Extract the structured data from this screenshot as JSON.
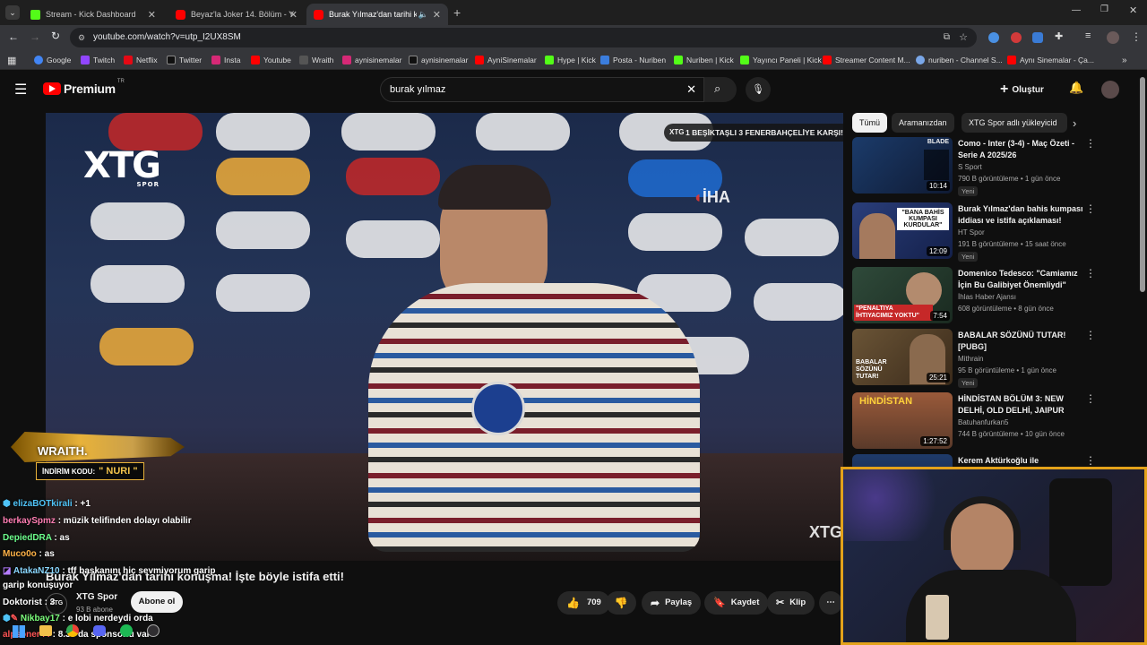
{
  "browser": {
    "tabs": [
      {
        "title": "Stream - Kick Dashboard",
        "active": false,
        "color": "#53fc18"
      },
      {
        "title": "Beyaz'la Joker 14. Bölüm - YouT",
        "active": false,
        "color": "#ff0000"
      },
      {
        "title": "Burak Yılmaz'dan tarihi konu",
        "active": true,
        "color": "#ff0000"
      }
    ],
    "url": "youtube.com/watch?v=utp_I2UX8SM",
    "bookmarks": [
      "Google",
      "Twitch",
      "Netflix",
      "Twitter",
      "Insta",
      "Youtube",
      "Wraith",
      "aynisinemalar",
      "aynisinemalar",
      "AyniSinemalar",
      "Hype | Kick",
      "Posta - Nuriben",
      "Nuriben | Kick",
      "Yayıncı Paneli | Kick",
      "Streamer Content M...",
      "nuriben - Channel S...",
      "Aynı Sinemalar - Ça..."
    ]
  },
  "youtube": {
    "logo": "Premium",
    "logo_sup": "TR",
    "search_value": "burak yılmaz",
    "create_label": "Oluştur"
  },
  "video": {
    "overlay_banner": "1 BEŞİKTAŞLI 3 FENERBAHÇELİYE KARŞI!",
    "channel_logo": "XTG",
    "channel_logo_sub": "SPOR",
    "watermark": "İHA",
    "corner_logo": "XTG",
    "title": "Burak Yılmaz'dan tarihi konuşma! İşte böyle istifa etti!",
    "channel_name": "XTG Spor",
    "subs": "93 B abone",
    "subscribe_label": "Abone ol",
    "likes": "709",
    "share_label": "Paylaş",
    "save_label": "Kaydet",
    "clip_label": "Klip"
  },
  "sponsor": {
    "brand": "WRAITH.",
    "code_label": "İNDİRİM KODU:",
    "code": "\" NURI \""
  },
  "chips": [
    "Tümü",
    "Aramanızdan",
    "XTG Spor adlı yükleyicid"
  ],
  "recommendations": [
    {
      "title": "Como - Inter (3-4) - Maç Özeti - Serie A 2025/26",
      "channel": "S Sport",
      "meta": "790 B görüntüleme • 1 gün önce",
      "badge": "Yeni",
      "duration": "10:14",
      "thumb_text": "BLADE"
    },
    {
      "title": "Burak Yılmaz'dan bahis kumpası iddiası ve istifa açıklaması!",
      "channel": "HT Spor",
      "meta": "191 B görüntüleme • 15 saat önce",
      "badge": "Yeni",
      "duration": "12:09",
      "thumb_text": "\"BANA BAHİS KUMPASI KURDULAR\""
    },
    {
      "title": "Domenico Tedesco: \"Camiamız İçin Bu Galibiyet Önemliydi\"",
      "channel": "İhlas Haber Ajansı",
      "meta": "608 görüntüleme • 8 gün önce",
      "badge": "",
      "duration": "7:54",
      "thumb_text": "\"PENALTIYA İHTIYACIMIZ YOKTU\""
    },
    {
      "title": "BABALAR SÖZÜNÜ TUTAR! [PUBG]",
      "channel": "Mithrain",
      "meta": "95 B görüntüleme • 1 gün önce",
      "badge": "Yeni",
      "duration": "25:21",
      "thumb_text": "BABALAR SÖZÜNÜ TUTAR!"
    },
    {
      "title": "HİNDİSTAN BÖLÜM 3: NEW DELHİ, OLD DELHİ, JAIPUR",
      "channel": "Batuhanfurkan5",
      "meta": "744 B görüntüleme • 10 gün önce",
      "badge": "",
      "duration": "1:27:52",
      "thumb_text": "HİNDİSTAN"
    },
    {
      "title": "Kerem Aktürkoğlu ile",
      "channel": "",
      "meta": "",
      "badge": "",
      "duration": "",
      "thumb_text": ""
    }
  ],
  "chat": [
    {
      "user": "elizaBOTkirali",
      "color": "#4fc3f7",
      "msg": " : +1"
    },
    {
      "user": "berkaySpmz",
      "color": "#ff7eb3",
      "msg": " : müzik telifinden dolayı olabilir"
    },
    {
      "user": "DepiedDRA",
      "color": "#6cff8c",
      "msg": " : as"
    },
    {
      "user": "Muco0o",
      "color": "#ffb347",
      "msg": " : as"
    },
    {
      "user": "AtakaNZ10",
      "color": "#8ad7ff",
      "msg": " : tff başkanını hiç sevmiyorum garip"
    },
    {
      "user": "",
      "color": "#fff",
      "msg": "garip konuşuyor"
    },
    {
      "user": "Doktorist",
      "color": "#ffffff",
      "msg": " : 3"
    },
    {
      "user": "Nikbay17",
      "color": "#7cff7c",
      "msg": " : e lobi nerdeydi orda"
    },
    {
      "user": "alpsoner44",
      "color": "#ff5555",
      "msg": " : 8.30 da sponsorlu var"
    }
  ]
}
